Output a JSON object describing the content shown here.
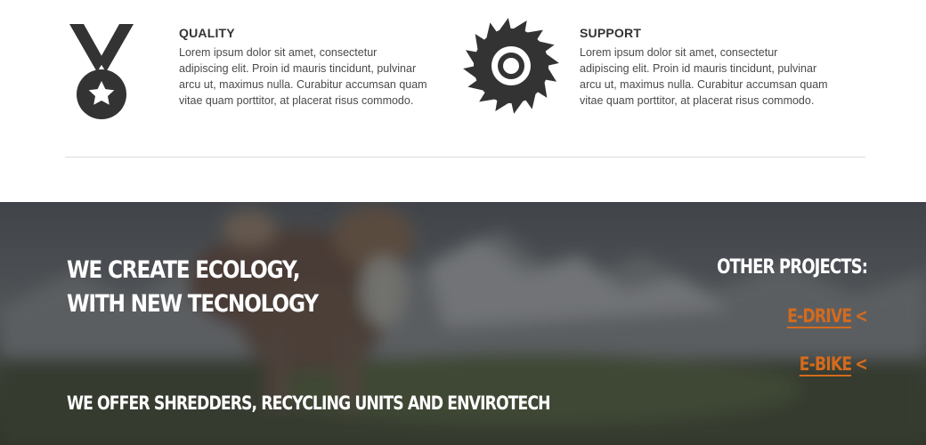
{
  "features": [
    {
      "icon": "medal-icon",
      "title": "QUALITY",
      "body": "Lorem ipsum dolor sit amet, consectetur adipiscing elit. Proin id mauris tincidunt, pulvinar arcu ut, maximus nulla. Curabitur accumsan quam vitae quam porttitor, at placerat risus commodo."
    },
    {
      "icon": "saw-blade-icon",
      "title": "SUPPORT",
      "body": "Lorem ipsum dolor sit amet, consectetur adipiscing elit. Proin id mauris tincidunt, pulvinar arcu ut, maximus nulla. Curabitur accumsan quam vitae quam porttitor, at placerat risus commodo."
    }
  ],
  "hero": {
    "heading_line1": "WE CREATE ECOLOGY,",
    "heading_line2": "WITH NEW TECNOLOGY",
    "subheading": "WE OFFER SHREDDERS, RECYCLING UNITS AND ENVIROTECH",
    "background": "blurred-mountain-landscape-photo"
  },
  "projects": {
    "title": "OTHER PROJECTS:",
    "links": [
      {
        "label": "E-DRIVE",
        "arrow": "<"
      },
      {
        "label": "E-BIKE",
        "arrow": "<"
      }
    ]
  },
  "colors": {
    "accent": "#d36b1e",
    "icon": "#333333",
    "text": "#4a4a4a",
    "hero_text": "#ffffff",
    "divider": "#dcdcdc"
  }
}
